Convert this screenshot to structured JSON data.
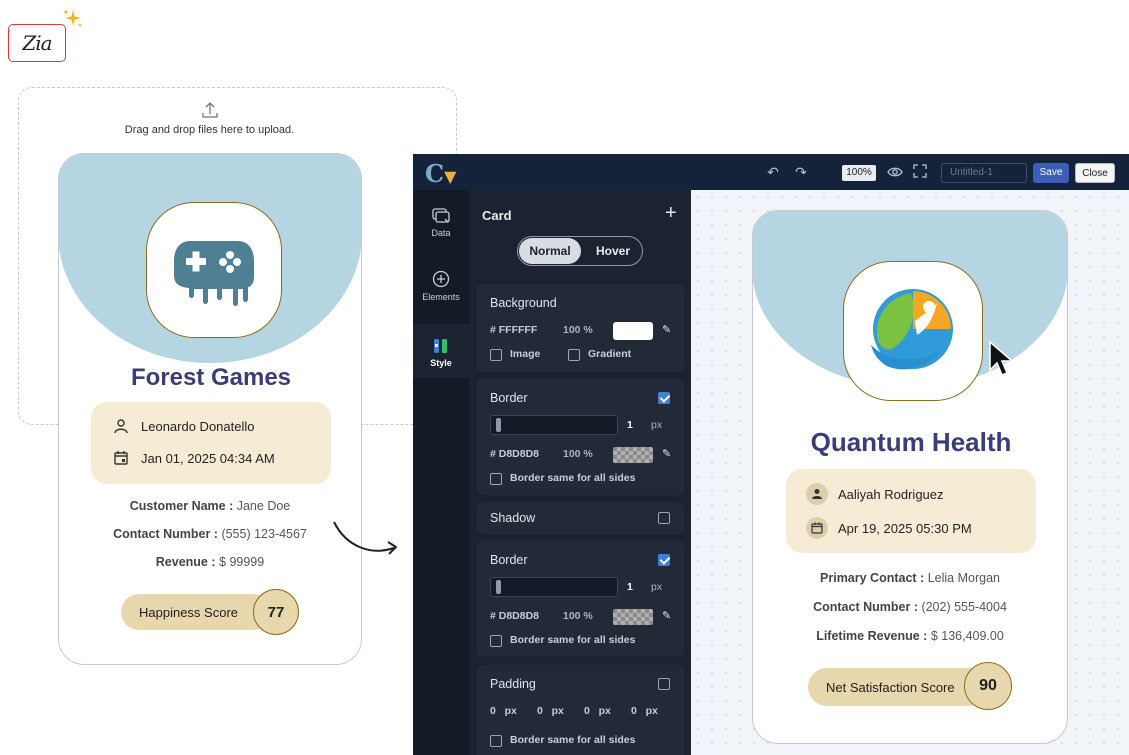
{
  "zia": {
    "logo_text": "Zia"
  },
  "upload": {
    "hint": "Drag and drop files here to upload."
  },
  "left_card": {
    "title": "Forest Games",
    "contact_name": "Leonardo Donatello",
    "datetime": "Jan 01, 2025 04:34 AM",
    "fields": [
      {
        "label": "Customer Name :",
        "value": "Jane Doe"
      },
      {
        "label": "Contact Number :",
        "value": "(555) 123-4567"
      },
      {
        "label": "Revenue :",
        "value": "$ 99999"
      }
    ],
    "score_label": "Happiness Score",
    "score_value": "77"
  },
  "editor": {
    "app_logo": "C",
    "zoom": "100%",
    "title_placeholder": "Untitled-1",
    "save_label": "Save",
    "close_label": "Close",
    "nav": [
      {
        "label": "Data",
        "icon": "data-icon"
      },
      {
        "label": "Elements",
        "icon": "plus-circle-icon"
      },
      {
        "label": "Style",
        "icon": "style-icon"
      }
    ],
    "panel": {
      "title": "Card",
      "state_tabs": [
        "Normal",
        "Hover"
      ],
      "background": {
        "title": "Background",
        "hex": "# FFFFFF",
        "opacity": "100 %",
        "image_label": "Image",
        "gradient_label": "Gradient"
      },
      "border1": {
        "title": "Border",
        "width": "1",
        "unit": "px",
        "hex": "# D8D8D8",
        "opacity": "100 %",
        "same_sides": "Border same for all sides"
      },
      "shadow": {
        "title": "Shadow"
      },
      "border2": {
        "title": "Border",
        "width": "1",
        "unit": "px",
        "hex": "# D8D8D8",
        "opacity": "100 %",
        "same_sides": "Border same for all sides"
      },
      "padding": {
        "title": "Padding",
        "values": [
          "0",
          "0",
          "0",
          "0"
        ],
        "unit": "px",
        "same_sides": "Border same for all sides"
      }
    }
  },
  "right_card": {
    "title": "Quantum Health",
    "contact_name": "Aaliyah Rodriguez",
    "datetime": "Apr 19, 2025 05:30 PM",
    "fields": [
      {
        "label": "Primary Contact :",
        "value": "Lelia Morgan"
      },
      {
        "label": "Contact Number :",
        "value": "(202) 555-4004"
      },
      {
        "label": "Lifetime Revenue :",
        "value": "$ 136,409.00"
      }
    ],
    "score_label": "Net Satisfaction Score",
    "score_value": "90"
  },
  "colors": {
    "accent_blue": "#b5d5e2",
    "title_navy": "#3b3d7a",
    "info_bg": "#f6ecd5",
    "score_bg": "#e6d7ad",
    "save_button": "#3d5eb8",
    "zia_red": "#e0383e"
  }
}
